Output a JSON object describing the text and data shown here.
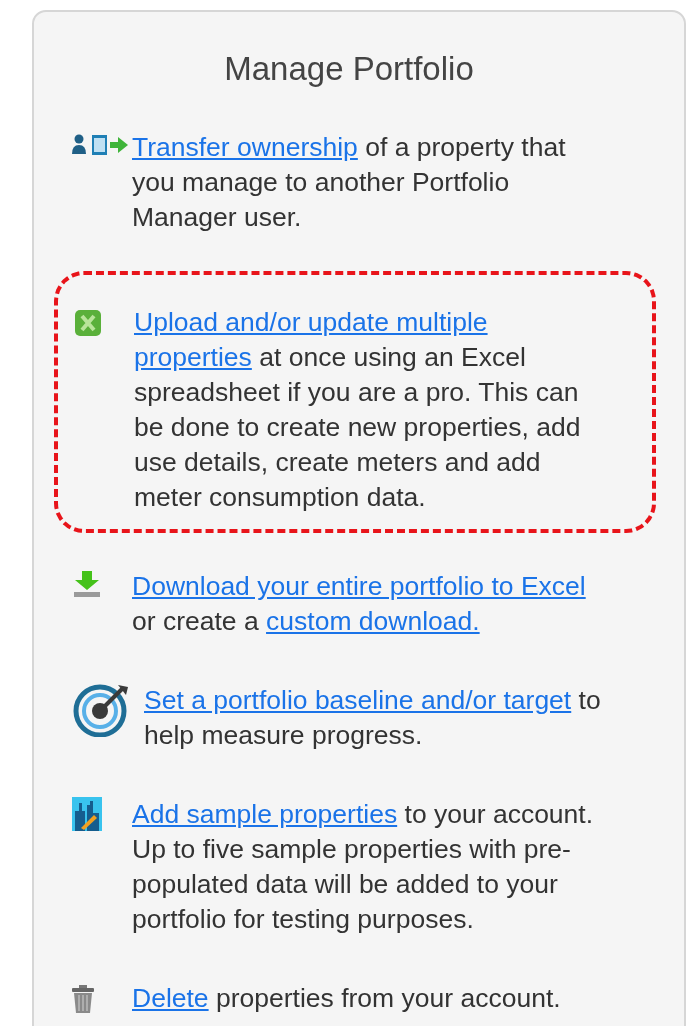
{
  "panel": {
    "title": "Manage Portfolio",
    "items": [
      {
        "kind": "transfer",
        "highlighted": false,
        "parts": [
          {
            "text": "Transfer ownership",
            "link": true
          },
          {
            "text": " of a property that you manage to another Portfolio Manager user.",
            "link": false
          }
        ]
      },
      {
        "kind": "spreadsheet",
        "highlighted": true,
        "parts": [
          {
            "text": "Upload and/or update multiple",
            "link": true
          },
          {
            "text": "properties",
            "link": true
          },
          {
            "text": " at once using an Excel spreadsheet if you are a pro. This can be done to create new properties, add use details, create meters and add meter consumption data.",
            "link": false
          }
        ]
      },
      {
        "kind": "download",
        "highlighted": false,
        "parts": [
          {
            "text": "Download your entire portfolio to Excel",
            "link": true
          },
          {
            "text": " or create a ",
            "link": false
          },
          {
            "text": "custom download.",
            "link": true
          }
        ]
      },
      {
        "kind": "target",
        "highlighted": false,
        "parts": [
          {
            "text": "Set a portfolio baseline and/or target",
            "link": true
          },
          {
            "text": " to help measure progress.",
            "link": false
          }
        ]
      },
      {
        "kind": "sample",
        "highlighted": false,
        "parts": [
          {
            "text": "Add sample properties",
            "link": true
          },
          {
            "text": " to your account. Up to five sample properties with pre-populated data will be added to your portfolio for testing purposes.",
            "link": false
          }
        ]
      },
      {
        "kind": "trash",
        "highlighted": false,
        "parts": [
          {
            "text": "Delete",
            "link": true
          },
          {
            "text": " properties from your account.",
            "link": false
          }
        ]
      }
    ]
  }
}
